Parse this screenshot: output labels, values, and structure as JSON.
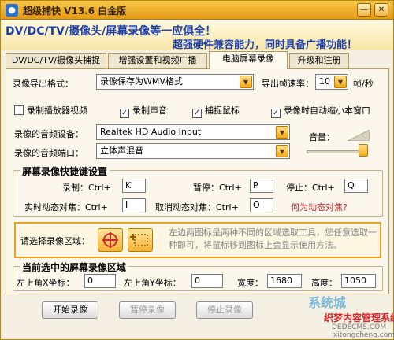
{
  "window": {
    "title": "超级捕快 V13.6 白金版",
    "banner_line1": "DV/DC/TV/摄像头/屏幕录像等一应俱全！",
    "banner_line2": "超强硬件兼容能力，同时具备广播功能！",
    "minimize_glyph": "—",
    "close_glyph": "✕"
  },
  "tabs": [
    {
      "label": "DV/DC/TV/摄像头捕捉"
    },
    {
      "label": "增强设置和视频广播"
    },
    {
      "label": "电脑屏幕录像"
    },
    {
      "label": "升级和注册"
    }
  ],
  "active_tab_index": 2,
  "form": {
    "export_format_label": "录像导出格式：",
    "export_format_value": "录像保存为WMV格式",
    "fps_label": "导出帧速率：",
    "fps_value": "10",
    "fps_unit": "帧/秒",
    "chk_player_video": {
      "label": "录制播放器视频",
      "checked": false
    },
    "chk_record_sound": {
      "label": "录制声音",
      "checked": true
    },
    "chk_capture_cursor": {
      "label": "捕捉鼠标",
      "checked": true
    },
    "chk_auto_minimize": {
      "label": "录像时自动缩小本窗口",
      "checked": true
    },
    "audio_device_label": "录像的音频设备：",
    "audio_device_value": "Realtek HD Audio Input",
    "audio_port_label": "录像的音频端口：",
    "audio_port_value": "立体声混音",
    "volume_label": "音量：",
    "volume_level": 1.0
  },
  "hotkeys": {
    "title": "屏幕录像快捷键设置",
    "record_label": "录制：Ctrl+",
    "record_key": "K",
    "pause_label": "暂停：Ctrl+",
    "pause_key": "P",
    "stop_label": "停止：Ctrl+",
    "stop_key": "Q",
    "focus_label": "实时动态对焦：Ctrl+",
    "focus_key": "I",
    "cancel_focus_label": "取消动态对焦：Ctrl+",
    "cancel_focus_key": "O",
    "what_is_link": "何为动态对焦?"
  },
  "area": {
    "label": "请选择录像区域：",
    "hint": "左边两图标是两种不同的区域选取工具，您任意选取一种即可，将鼠标移到图标上会显示使用方法。"
  },
  "current_area": {
    "title": "当前选中的屏幕录像区域",
    "x_label": "左上角X坐标：",
    "x_value": "0",
    "y_label": "左上角Y坐标：",
    "y_value": "0",
    "width_label": "宽度：",
    "width_value": "1680",
    "height_label": "高度：",
    "height_value": "1050"
  },
  "buttons": {
    "start": "开始录像",
    "pause": "暂停录像",
    "stop": "停止录像"
  },
  "watermark": {
    "site_a": "系统城",
    "line1": "织梦内容管理系统",
    "line2": "DEDECMS.COM",
    "line3": "xitongcheng.com"
  },
  "colors": {
    "accent": "#f0a818",
    "banner_text": "#1f3fa8",
    "link": "#c0202a"
  }
}
